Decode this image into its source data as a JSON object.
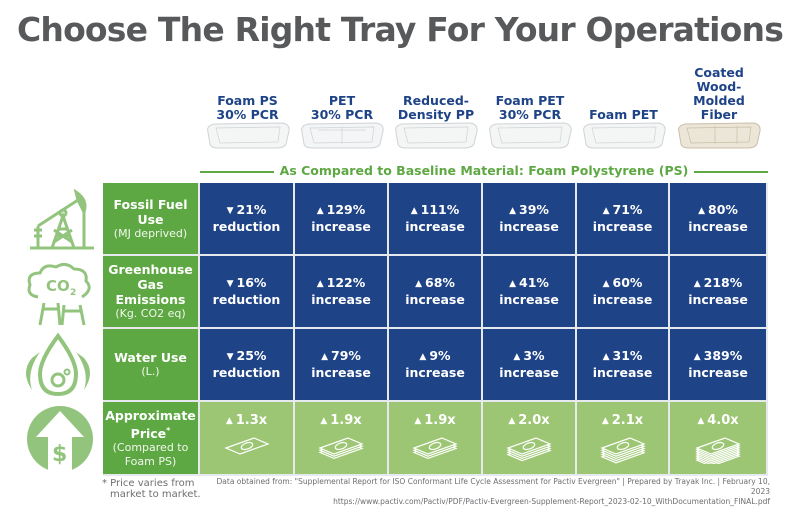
{
  "title": "Choose The Right Tray For Your Operations",
  "products": [
    {
      "name_line1": "Foam PS",
      "name_line2": "30% PCR",
      "name_line3": "",
      "tray": "foam"
    },
    {
      "name_line1": "PET",
      "name_line2": "30% PCR",
      "name_line3": "",
      "tray": "clear"
    },
    {
      "name_line1": "Reduced-",
      "name_line2": "Density PP",
      "name_line3": "",
      "tray": "foam"
    },
    {
      "name_line1": "Foam PET",
      "name_line2": "30% PCR",
      "name_line3": "",
      "tray": "foam"
    },
    {
      "name_line1": "",
      "name_line2": "Foam PET",
      "name_line3": "",
      "tray": "foam"
    },
    {
      "name_line1": "Coated",
      "name_line2": "Wood-Molded",
      "name_line3": "Fiber",
      "tray": "fiber"
    }
  ],
  "baseline_text": "As Compared to Baseline Material: Foam Polystyrene (PS)",
  "colors": {
    "title": "#58595b",
    "blue": "#1e4387",
    "green": "#5ea843",
    "light_green": "#9cc673",
    "icon_green": "#93c47d"
  },
  "rows": [
    {
      "icon": "oil-pump-icon",
      "label_main": "Fossil Fuel Use",
      "label_sub": "(MJ deprived)",
      "cells": [
        {
          "direction": "down",
          "value": "21%",
          "word": "reduction"
        },
        {
          "direction": "up",
          "value": "129%",
          "word": "increase"
        },
        {
          "direction": "up",
          "value": "111%",
          "word": "increase"
        },
        {
          "direction": "up",
          "value": "39%",
          "word": "increase"
        },
        {
          "direction": "up",
          "value": "71%",
          "word": "increase"
        },
        {
          "direction": "up",
          "value": "80%",
          "word": "increase"
        }
      ]
    },
    {
      "icon": "co2-emissions-icon",
      "label_main": "Greenhouse Gas Emissions",
      "label_sub": "(Kg. CO2 eq)",
      "cells": [
        {
          "direction": "down",
          "value": "16%",
          "word": "reduction"
        },
        {
          "direction": "up",
          "value": "122%",
          "word": "increase"
        },
        {
          "direction": "up",
          "value": "68%",
          "word": "increase"
        },
        {
          "direction": "up",
          "value": "41%",
          "word": "increase"
        },
        {
          "direction": "up",
          "value": "60%",
          "word": "increase"
        },
        {
          "direction": "up",
          "value": "218%",
          "word": "increase"
        }
      ]
    },
    {
      "icon": "water-drop-icon",
      "label_main": "Water Use",
      "label_sub": "(L.)",
      "cells": [
        {
          "direction": "down",
          "value": "25%",
          "word": "reduction"
        },
        {
          "direction": "up",
          "value": "79%",
          "word": "increase"
        },
        {
          "direction": "up",
          "value": "9%",
          "word": "increase"
        },
        {
          "direction": "up",
          "value": "3%",
          "word": "increase"
        },
        {
          "direction": "up",
          "value": "31%",
          "word": "increase"
        },
        {
          "direction": "up",
          "value": "389%",
          "word": "increase"
        }
      ]
    }
  ],
  "price_row": {
    "icon": "price-increase-icon",
    "label_main": "Approximate Price",
    "label_asterisk": "*",
    "label_sub": "(Compared to Foam PS)",
    "cells": [
      {
        "direction": "up",
        "value": "1.3x",
        "stack": 1
      },
      {
        "direction": "up",
        "value": "1.9x",
        "stack": 3
      },
      {
        "direction": "up",
        "value": "1.9x",
        "stack": 3
      },
      {
        "direction": "up",
        "value": "2.0x",
        "stack": 4
      },
      {
        "direction": "up",
        "value": "2.1x",
        "stack": 5
      },
      {
        "direction": "up",
        "value": "4.0x",
        "stack": 8
      }
    ]
  },
  "footnote": "* Price varies from market to market.",
  "source_line1": "Data obtained from: \"Supplemental Report for ISO Conformant Life Cycle Assessment for Pactiv Evergreen\"  |  Prepared by Trayak Inc.  |  February 10, 2023",
  "source_line2": "https://www.pactiv.com/Pactiv/PDF/Pactiv-Evergreen-Supplement-Report_2023-02-10_WithDocumentation_FINAL.pdf"
}
